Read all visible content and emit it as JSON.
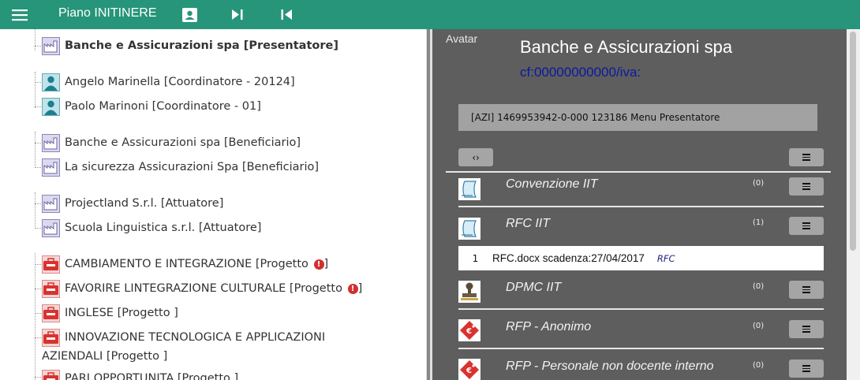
{
  "topbar": {
    "title": "Piano INITINERE",
    "icons": [
      "menu-icon",
      "contact-card-icon",
      "skip-next-icon",
      "skip-previous-icon"
    ],
    "color": "#26957a"
  },
  "tree": {
    "nodes": [
      {
        "label": "Banche e Assicurazioni spa [Presentatore]",
        "icon": "factory-icon"
      },
      {
        "label": "Angelo Marinella [Coordinatore - 20124]",
        "icon": "person-icon"
      },
      {
        "label": "Paolo Marinoni [Coordinatore - 01]",
        "icon": "person-icon"
      },
      {
        "label": "Banche e Assicurazioni spa [Beneficiario]",
        "icon": "factory-icon"
      },
      {
        "label": "La sicurezza Assicurazioni Spa [Beneficiario]",
        "icon": "factory-icon"
      },
      {
        "label": "Projectland S.r.l. [Attuatore]",
        "icon": "factory-icon"
      },
      {
        "label": "Scuola Linguistica s.r.l. [Attuatore]",
        "icon": "factory-icon"
      },
      {
        "label": "CAMBIAMENTO E INTEGRAZIONE [Progetto",
        "suffix": "]",
        "icon": "project-icon",
        "warning": "!"
      },
      {
        "label": "FAVORIRE LINTEGRAZIONE CULTURALE [Progetto",
        "suffix": "]",
        "icon": "project-icon",
        "warning": "!"
      },
      {
        "label": "INGLESE [Progetto ]",
        "icon": "project-icon"
      },
      {
        "label": "INNOVAZIONE TECNOLOGICA E APPLICAZIONI",
        "icon": "project-icon"
      },
      {
        "label": "AZIENDALI [Progetto ]"
      },
      {
        "label": "PARI OPPORTUNITA [Progetto ]",
        "icon": "project-icon"
      }
    ]
  },
  "detail": {
    "avatar_label": "Avatar",
    "company_name": "Banche e Assicurazioni spa",
    "cf_iva": "cf:00000000000/iva:",
    "menu_bar": "[AZI] 1469953942-0-000 123186 Menu Presentatore",
    "toggle_label": "‹›",
    "documents": [
      {
        "title": "Convenzione IIT",
        "count": "(0)",
        "icon": "document-icon"
      },
      {
        "title": "RFC IIT",
        "count": "(1)",
        "icon": "document-icon"
      },
      {
        "title": "DPMC IIT",
        "count": "(0)",
        "icon": "stamp-icon"
      },
      {
        "title": "RFP - Anonimo",
        "count": "(0)",
        "icon": "euro-tag-icon"
      },
      {
        "title": "RFP - Personale non docente interno",
        "count": "(0)",
        "icon": "euro-tag-icon"
      }
    ],
    "file": {
      "num": "1",
      "name": "RFC.docx scadenza:27/04/2017",
      "type": "RFC"
    }
  }
}
